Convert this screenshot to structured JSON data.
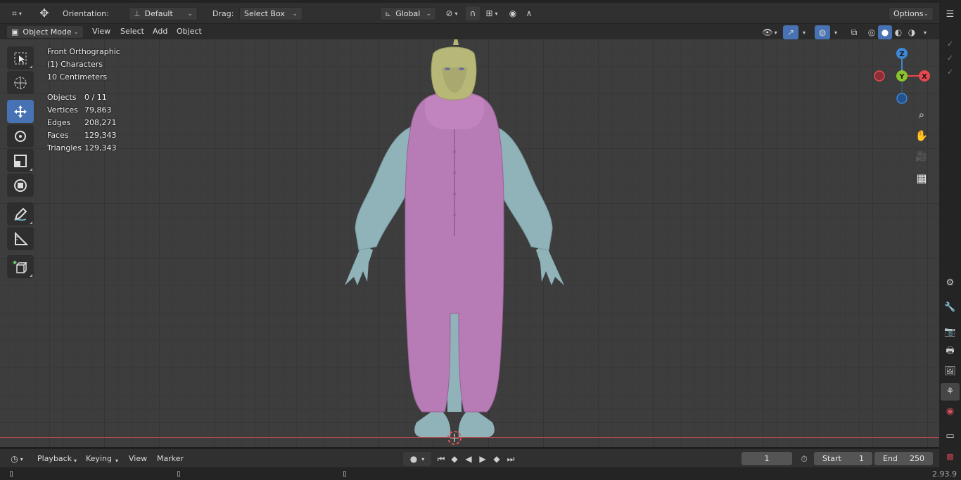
{
  "header": {
    "orientation_label": "Orientation:",
    "orientation_value": "Default",
    "drag_label": "Drag:",
    "drag_value": "Select Box",
    "transform_space": "Global",
    "options_label": "Options"
  },
  "viewport_header": {
    "mode": "Object Mode",
    "menus": [
      "View",
      "Select",
      "Add",
      "Object"
    ]
  },
  "overlay": {
    "view_name": "Front Orthographic",
    "collection": "(1) Characters",
    "scale": "10 Centimeters",
    "stats": [
      {
        "label": "Objects",
        "value": "0 / 11"
      },
      {
        "label": "Vertices",
        "value": "79,863"
      },
      {
        "label": "Edges",
        "value": "208,271"
      },
      {
        "label": "Faces",
        "value": "129,343"
      },
      {
        "label": "Triangles",
        "value": "129,343"
      }
    ]
  },
  "gizmo": {
    "z": "Z",
    "y": "Y",
    "x": "X"
  },
  "timeline": {
    "menus": [
      "Playback",
      "Keying",
      "View",
      "Marker"
    ],
    "current_frame": "1",
    "start_label": "Start",
    "start_value": "1",
    "end_label": "End",
    "end_value": "250"
  },
  "status": {
    "version": "2.93.9"
  },
  "colors": {
    "accent": "#4772b3",
    "axis_x": "#e8474f",
    "axis_y": "#8bc42a",
    "axis_z": "#3d87d6",
    "outfit_pink": "#b77bb5",
    "skin_blue": "#8fb3b9",
    "hair_yellow": "#b7b878"
  }
}
